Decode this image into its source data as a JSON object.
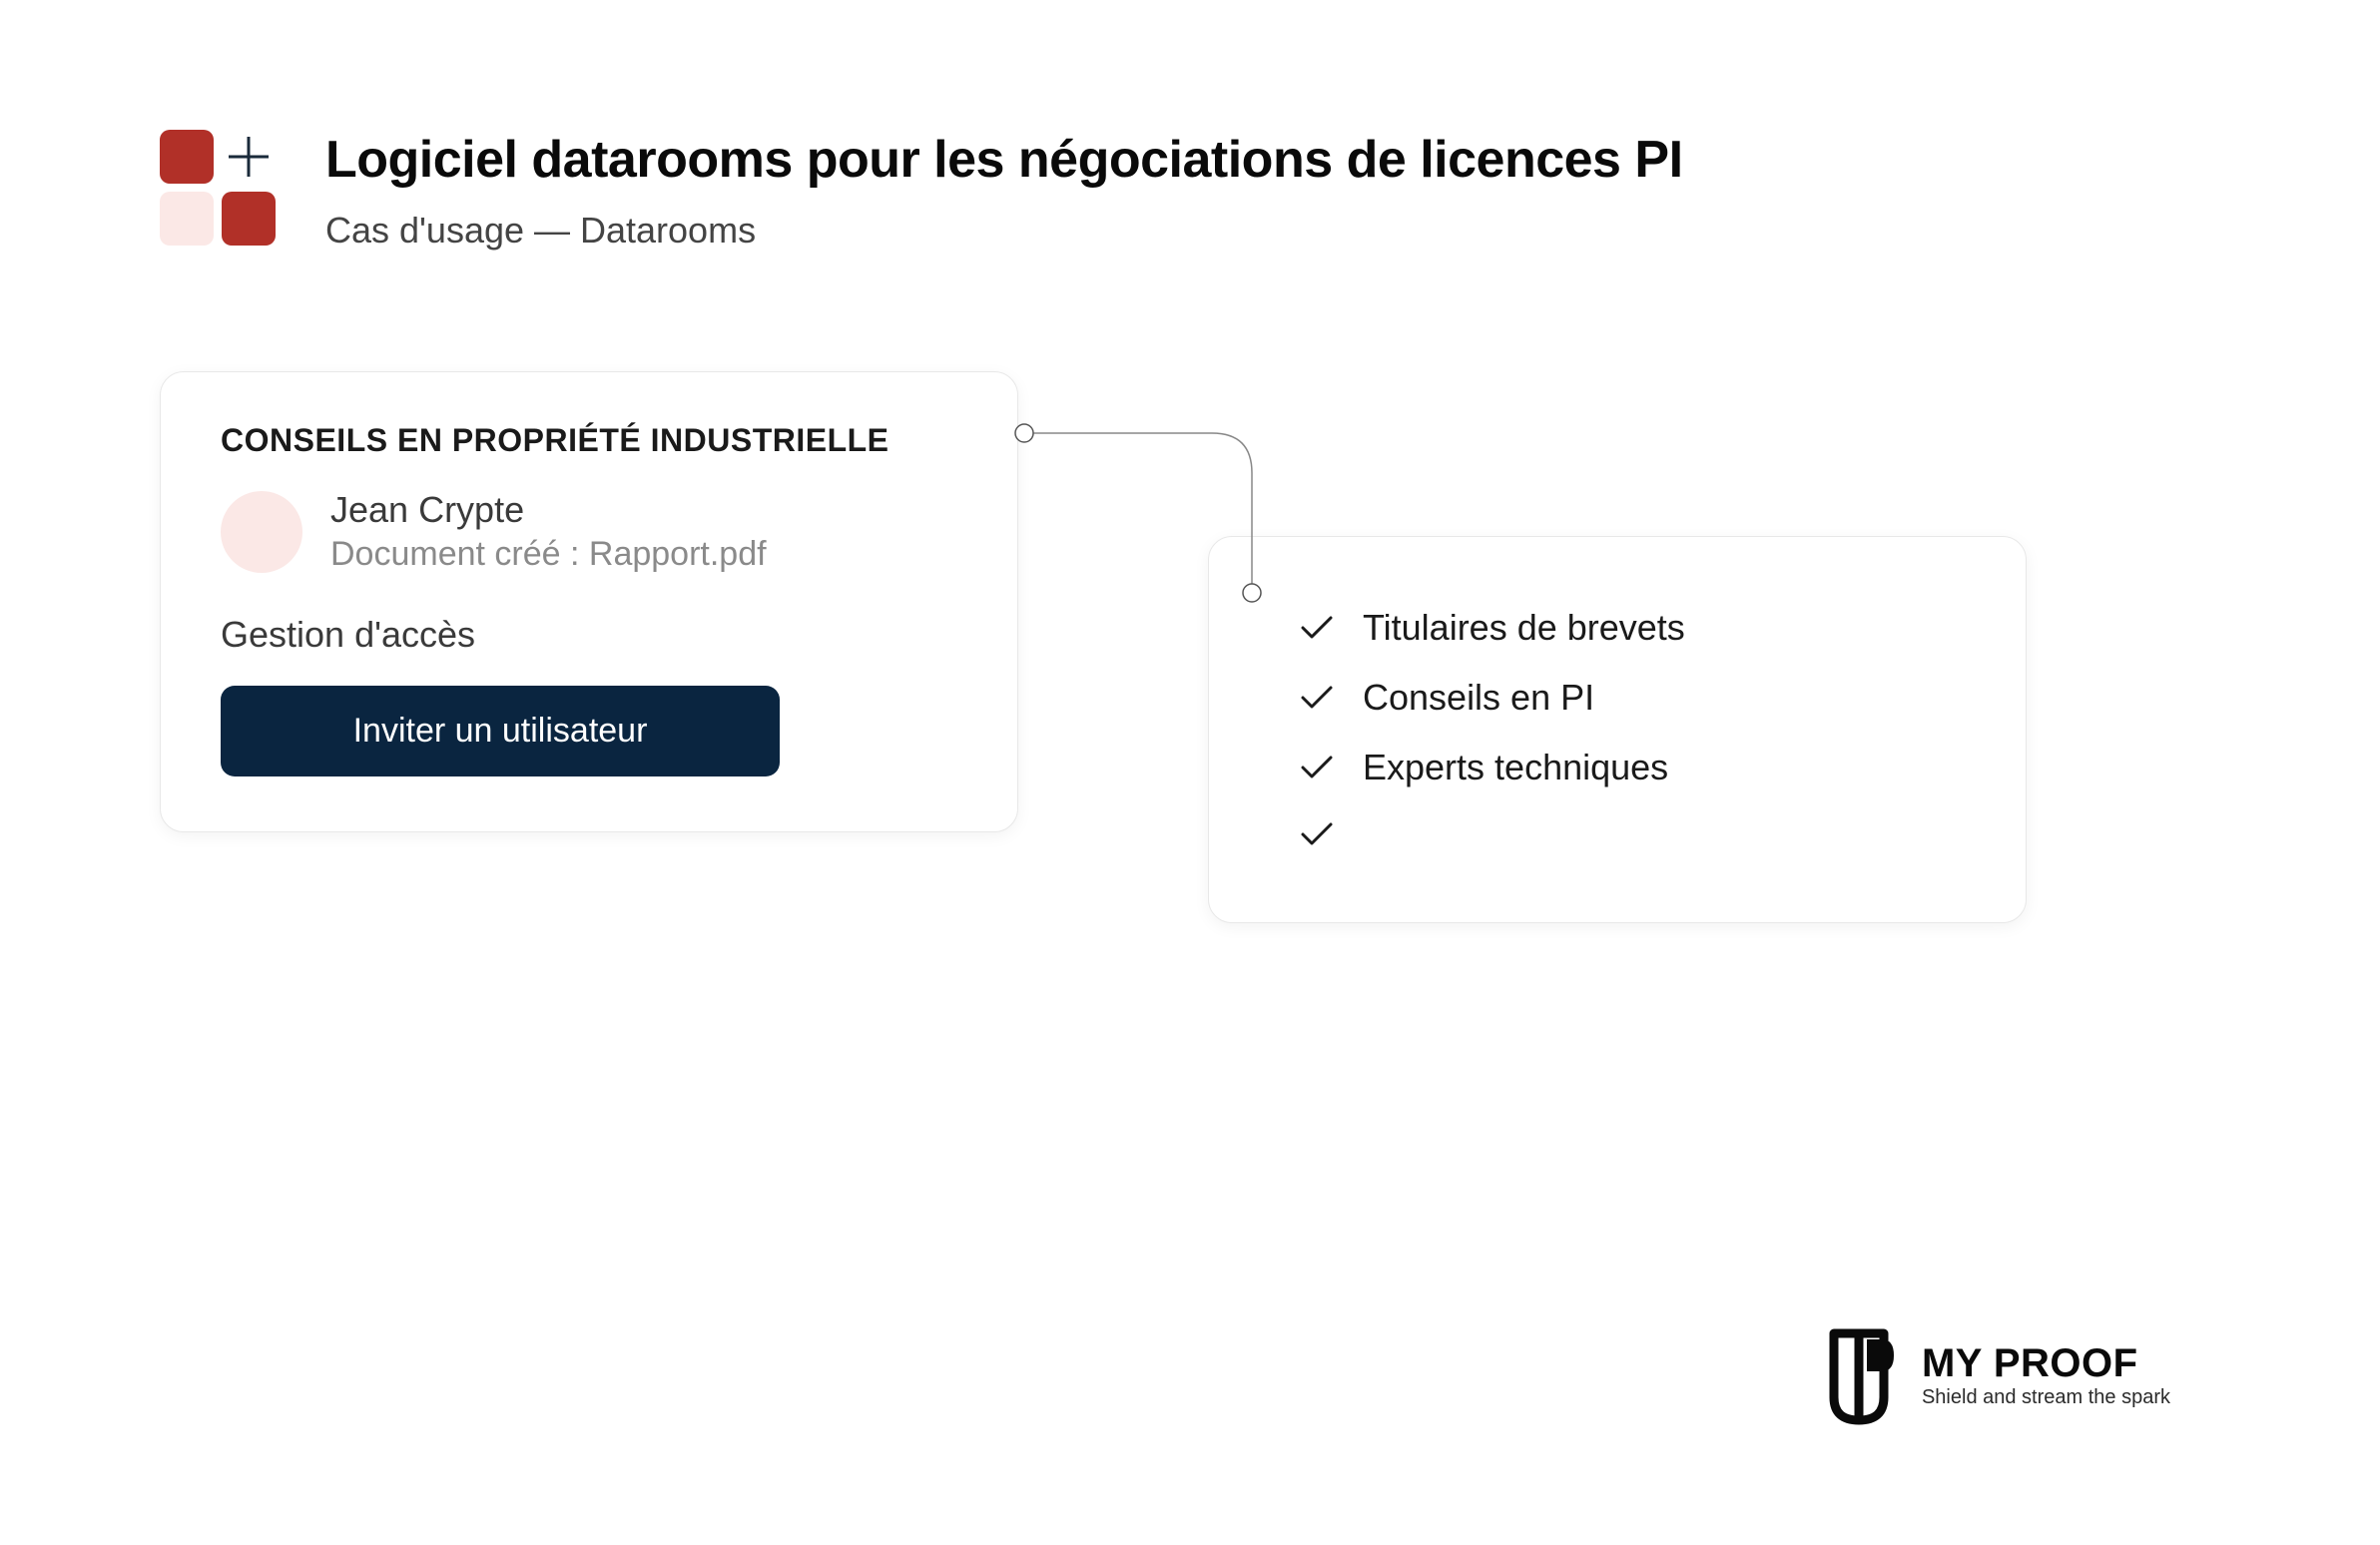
{
  "header": {
    "title": "Logiciel datarooms pour les négociations de licences PI",
    "subtitle": "Cas d'usage — Datarooms"
  },
  "left_card": {
    "title": "CONSEILS EN PROPRIÉTÉ INDUSTRIELLE",
    "user_name": "Jean Crypte",
    "user_doc": "Document créé : Rapport.pdf",
    "access_label": "Gestion d'accès",
    "invite_button": "Inviter un utilisateur"
  },
  "right_card": {
    "items": [
      "Titulaires de brevets",
      "Conseils en PI",
      "Experts techniques",
      ""
    ]
  },
  "brand": {
    "name": "MY PROOF",
    "tagline": "Shield and stream the spark"
  }
}
